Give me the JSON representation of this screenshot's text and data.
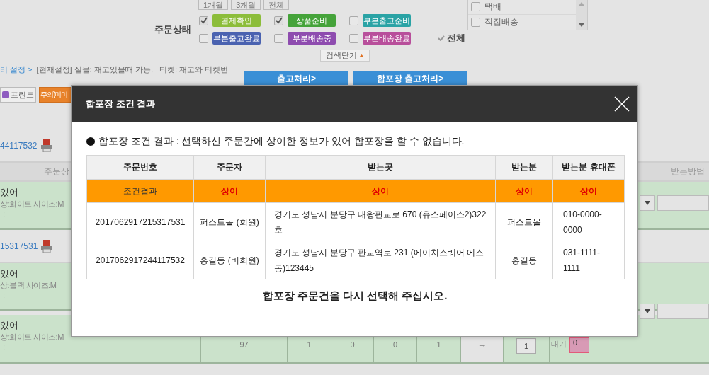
{
  "period_buttons": [
    "1개월",
    "3개월",
    "전체"
  ],
  "order_status": {
    "label": "주문상태",
    "all_label": "전체",
    "statuses": [
      {
        "label": "결제확인",
        "checked": true,
        "color": "#8cbd3a"
      },
      {
        "label": "상품준비",
        "checked": true,
        "color": "#45a33a"
      },
      {
        "label": "부분출고준비",
        "checked": false,
        "color": "#2aa3a5"
      },
      {
        "label": "부분출고완료",
        "checked": false,
        "color": "#4a62b0"
      },
      {
        "label": "부분배송중",
        "checked": false,
        "color": "#8e4caf"
      },
      {
        "label": "부분배송완료",
        "checked": false,
        "color": "#b84f9b"
      }
    ]
  },
  "delivery_list": [
    {
      "label": "택배",
      "checked": false
    },
    {
      "label": "직접배송",
      "checked": false
    }
  ],
  "search_toggle": "검색닫기",
  "settings_link": "리 설정 >",
  "settings_note": "[현재설정] 실물: 재고있을때 가능,   티켓: 재고와 티켓번",
  "action_buttons": [
    "출고처리>",
    "합포장 출고처리>"
  ],
  "toolbar_buttons": [
    "프린트",
    "주의)미미"
  ],
  "background_rows": [
    {
      "kind": "order",
      "order_no": "44117532"
    },
    {
      "kind": "header",
      "columns": [
        "주문상",
        "받는방법"
      ]
    },
    {
      "kind": "item",
      "lines": [
        "있어",
        "상:화이트 사이즈:M",
        ":"
      ]
    },
    {
      "kind": "order",
      "order_no": "15317531"
    },
    {
      "kind": "item",
      "lines": [
        "있어",
        "상:블랙 사이즈:M",
        ":"
      ]
    },
    {
      "kind": "item",
      "lines": [
        "있어",
        "상:화이트 사이즈:M",
        ":"
      ],
      "cells": [
        "97",
        "1",
        "0",
        "0",
        "1"
      ],
      "arrow": "→",
      "quantity": "1",
      "state": "대기",
      "count": "0"
    }
  ],
  "modal": {
    "title": "합포장 조건 결과",
    "message": "합포장 조건 결과 : 선택하신 주문간에 상이한 정보가 있어 합포장을 할 수 없습니다.",
    "columns": [
      "주문번호",
      "주문자",
      "받는곳",
      "받는분",
      "받는분 휴대폰"
    ],
    "result_row": {
      "label": "조건결과",
      "values": [
        "상이",
        "상이",
        "상이",
        "상이"
      ]
    },
    "rows": [
      [
        "2017062917215317531",
        "퍼스트몰 (회원)",
        "경기도 성남시 분당구 대왕판교로 670 (유스페이스2)322호",
        "퍼스트몰",
        "010-0000-0000"
      ],
      [
        "2017062917244117532",
        "홍길동 (비회원)",
        "경기도 성남시 분당구 판교역로 231 (에이치스퀘어 에스동)123445",
        "홍길동",
        "031-1111-1111"
      ]
    ],
    "footer": "합포장 주문건을 다시 선택해 주십시오."
  }
}
